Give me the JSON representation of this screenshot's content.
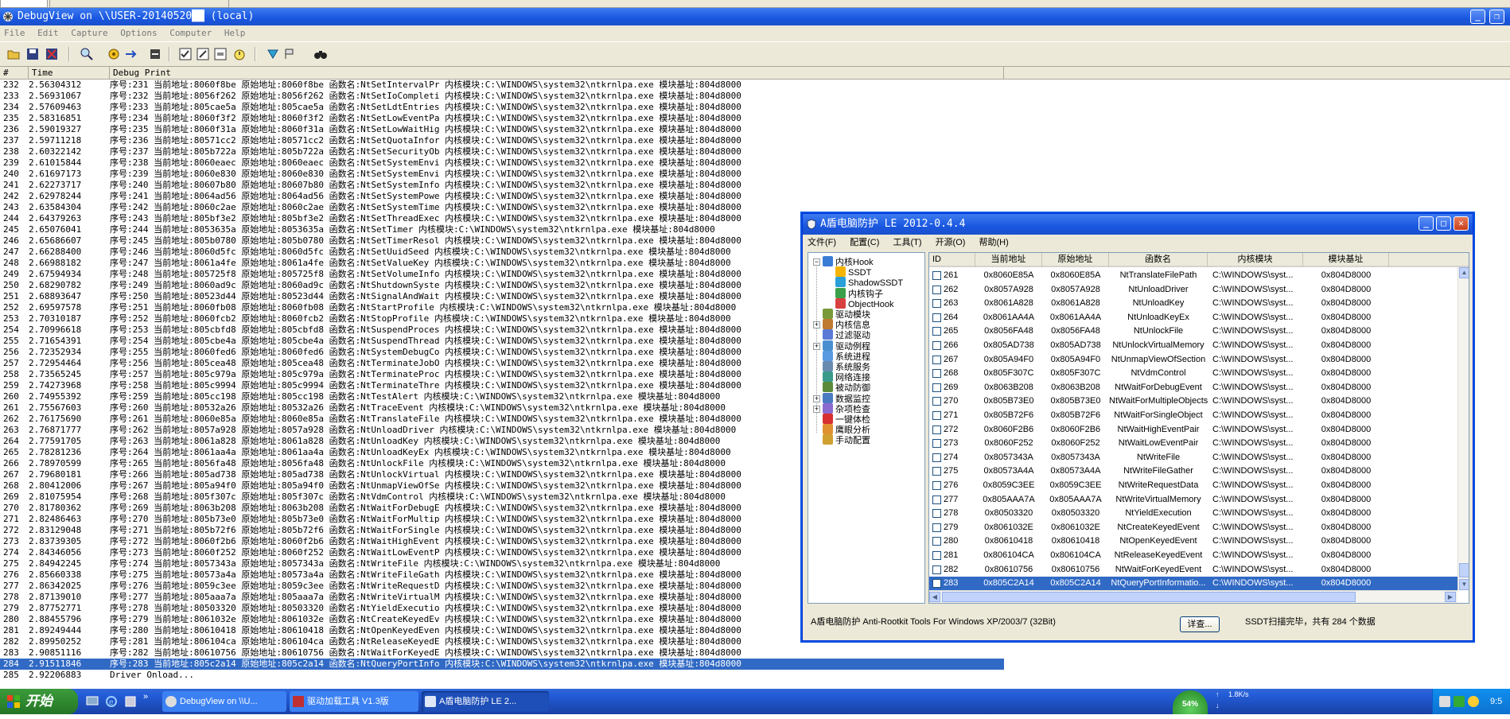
{
  "debugview": {
    "title": "DebugView on \\\\USER-20140520██ (local)",
    "menu": [
      "File",
      "Edit",
      "Capture",
      "Options",
      "Computer",
      "Help"
    ],
    "columns": {
      "num": "#",
      "time": "Time",
      "print": "Debug Print"
    },
    "rows": [
      [
        "232",
        "2.56304312",
        "序号:231 当前地址:8060f8be 原始地址:8060f8be 函数名:NtSetIntervalPr 内核模块:C:\\WINDOWS\\system32\\ntkrnlpa.exe 模块基址:804d8000"
      ],
      [
        "233",
        "2.56931067",
        "序号:232 当前地址:8056f262 原始地址:8056f262 函数名:NtSetIoCompleti 内核模块:C:\\WINDOWS\\system32\\ntkrnlpa.exe 模块基址:804d8000"
      ],
      [
        "234",
        "2.57609463",
        "序号:233 当前地址:805cae5a 原始地址:805cae5a 函数名:NtSetLdtEntries 内核模块:C:\\WINDOWS\\system32\\ntkrnlpa.exe 模块基址:804d8000"
      ],
      [
        "235",
        "2.58316851",
        "序号:234 当前地址:8060f3f2 原始地址:8060f3f2 函数名:NtSetLowEventPa 内核模块:C:\\WINDOWS\\system32\\ntkrnlpa.exe 模块基址:804d8000"
      ],
      [
        "236",
        "2.59019327",
        "序号:235 当前地址:8060f31a 原始地址:8060f31a 函数名:NtSetLowWaitHig 内核模块:C:\\WINDOWS\\system32\\ntkrnlpa.exe 模块基址:804d8000"
      ],
      [
        "237",
        "2.59711218",
        "序号:236 当前地址:80571cc2 原始地址:80571cc2 函数名:NtSetQuotaInfor 内核模块:C:\\WINDOWS\\system32\\ntkrnlpa.exe 模块基址:804d8000"
      ],
      [
        "238",
        "2.60322142",
        "序号:237 当前地址:805b722a 原始地址:805b722a 函数名:NtSetSecurityOb 内核模块:C:\\WINDOWS\\system32\\ntkrnlpa.exe 模块基址:804d8000"
      ],
      [
        "239",
        "2.61015844",
        "序号:238 当前地址:8060eaec 原始地址:8060eaec 函数名:NtSetSystemEnvi 内核模块:C:\\WINDOWS\\system32\\ntkrnlpa.exe 模块基址:804d8000"
      ],
      [
        "240",
        "2.61697173",
        "序号:239 当前地址:8060e830 原始地址:8060e830 函数名:NtSetSystemEnvi 内核模块:C:\\WINDOWS\\system32\\ntkrnlpa.exe 模块基址:804d8000"
      ],
      [
        "241",
        "2.62273717",
        "序号:240 当前地址:80607b80 原始地址:80607b80 函数名:NtSetSystemInfo 内核模块:C:\\WINDOWS\\system32\\ntkrnlpa.exe 模块基址:804d8000"
      ],
      [
        "242",
        "2.62978244",
        "序号:241 当前地址:8064ad56 原始地址:8064ad56 函数名:NtSetSystemPowe 内核模块:C:\\WINDOWS\\system32\\ntkrnlpa.exe 模块基址:804d8000"
      ],
      [
        "243",
        "2.63584304",
        "序号:242 当前地址:8060c2ae 原始地址:8060c2ae 函数名:NtSetSystemTime 内核模块:C:\\WINDOWS\\system32\\ntkrnlpa.exe 模块基址:804d8000"
      ],
      [
        "244",
        "2.64379263",
        "序号:243 当前地址:805bf3e2 原始地址:805bf3e2 函数名:NtSetThreadExec 内核模块:C:\\WINDOWS\\system32\\ntkrnlpa.exe 模块基址:804d8000"
      ],
      [
        "245",
        "2.65076041",
        "序号:244 当前地址:8053635a 原始地址:8053635a 函数名:NtSetTimer 内核模块:C:\\WINDOWS\\system32\\ntkrnlpa.exe 模块基址:804d8000"
      ],
      [
        "246",
        "2.65686607",
        "序号:245 当前地址:805b0780 原始地址:805b0780 函数名:NtSetTimerResol 内核模块:C:\\WINDOWS\\system32\\ntkrnlpa.exe 模块基址:804d8000"
      ],
      [
        "247",
        "2.66288400",
        "序号:246 当前地址:8060d5fc 原始地址:8060d5fc 函数名:NtSetUuidSeed 内核模块:C:\\WINDOWS\\system32\\ntkrnlpa.exe 模块基址:804d8000"
      ],
      [
        "248",
        "2.66988182",
        "序号:247 当前地址:8061a4fe 原始地址:8061a4fe 函数名:NtSetValueKey 内核模块:C:\\WINDOWS\\system32\\ntkrnlpa.exe 模块基址:804d8000"
      ],
      [
        "249",
        "2.67594934",
        "序号:248 当前地址:805725f8 原始地址:805725f8 函数名:NtSetVolumeInfo 内核模块:C:\\WINDOWS\\system32\\ntkrnlpa.exe 模块基址:804d8000"
      ],
      [
        "250",
        "2.68290782",
        "序号:249 当前地址:8060ad9c 原始地址:8060ad9c 函数名:NtShutdownSyste 内核模块:C:\\WINDOWS\\system32\\ntkrnlpa.exe 模块基址:804d8000"
      ],
      [
        "251",
        "2.68893647",
        "序号:250 当前地址:80523d44 原始地址:80523d44 函数名:NtSignalAndWait 内核模块:C:\\WINDOWS\\system32\\ntkrnlpa.exe 模块基址:804d8000"
      ],
      [
        "252",
        "2.69597578",
        "序号:251 当前地址:8060fb08 原始地址:8060fb08 函数名:NtStartProfile 内核模块:C:\\WINDOWS\\system32\\ntkrnlpa.exe 模块基址:804d8000"
      ],
      [
        "253",
        "2.70310187",
        "序号:252 当前地址:8060fcb2 原始地址:8060fcb2 函数名:NtStopProfile 内核模块:C:\\WINDOWS\\system32\\ntkrnlpa.exe 模块基址:804d8000"
      ],
      [
        "254",
        "2.70996618",
        "序号:253 当前地址:805cbfd8 原始地址:805cbfd8 函数名:NtSuspendProces 内核模块:C:\\WINDOWS\\system32\\ntkrnlpa.exe 模块基址:804d8000"
      ],
      [
        "255",
        "2.71654391",
        "序号:254 当前地址:805cbe4a 原始地址:805cbe4a 函数名:NtSuspendThread 内核模块:C:\\WINDOWS\\system32\\ntkrnlpa.exe 模块基址:804d8000"
      ],
      [
        "256",
        "2.72352934",
        "序号:255 当前地址:8060fed6 原始地址:8060fed6 函数名:NtSystemDebugCo 内核模块:C:\\WINDOWS\\system32\\ntkrnlpa.exe 模块基址:804d8000"
      ],
      [
        "257",
        "2.72954464",
        "序号:256 当前地址:805cea48 原始地址:805cea48 函数名:NtTerminateJobO 内核模块:C:\\WINDOWS\\system32\\ntkrnlpa.exe 模块基址:804d8000"
      ],
      [
        "258",
        "2.73565245",
        "序号:257 当前地址:805c979a 原始地址:805c979a 函数名:NtTerminateProc 内核模块:C:\\WINDOWS\\system32\\ntkrnlpa.exe 模块基址:804d8000"
      ],
      [
        "259",
        "2.74273968",
        "序号:258 当前地址:805c9994 原始地址:805c9994 函数名:NtTerminateThre 内核模块:C:\\WINDOWS\\system32\\ntkrnlpa.exe 模块基址:804d8000"
      ],
      [
        "260",
        "2.74955392",
        "序号:259 当前地址:805cc198 原始地址:805cc198 函数名:NtTestAlert 内核模块:C:\\WINDOWS\\system32\\ntkrnlpa.exe 模块基址:804d8000"
      ],
      [
        "261",
        "2.75567603",
        "序号:260 当前地址:80532a26 原始地址:80532a26 函数名:NtTraceEvent 内核模块:C:\\WINDOWS\\system32\\ntkrnlpa.exe 模块基址:804d8000"
      ],
      [
        "262",
        "2.76175690",
        "序号:261 当前地址:8060e85a 原始地址:8060e85a 函数名:NtTranslateFile 内核模块:C:\\WINDOWS\\system32\\ntkrnlpa.exe 模块基址:804d8000"
      ],
      [
        "263",
        "2.76871777",
        "序号:262 当前地址:8057a928 原始地址:8057a928 函数名:NtUnloadDriver 内核模块:C:\\WINDOWS\\system32\\ntkrnlpa.exe 模块基址:804d8000"
      ],
      [
        "264",
        "2.77591705",
        "序号:263 当前地址:8061a828 原始地址:8061a828 函数名:NtUnloadKey 内核模块:C:\\WINDOWS\\system32\\ntkrnlpa.exe 模块基址:804d8000"
      ],
      [
        "265",
        "2.78281236",
        "序号:264 当前地址:8061aa4a 原始地址:8061aa4a 函数名:NtUnloadKeyEx 内核模块:C:\\WINDOWS\\system32\\ntkrnlpa.exe 模块基址:804d8000"
      ],
      [
        "266",
        "2.78970599",
        "序号:265 当前地址:8056fa48 原始地址:8056fa48 函数名:NtUnlockFile 内核模块:C:\\WINDOWS\\system32\\ntkrnlpa.exe 模块基址:804d8000"
      ],
      [
        "267",
        "2.79680181",
        "序号:266 当前地址:805ad738 原始地址:805ad738 函数名:NtUnlockVirtual 内核模块:C:\\WINDOWS\\system32\\ntkrnlpa.exe 模块基址:804d8000"
      ],
      [
        "268",
        "2.80412006",
        "序号:267 当前地址:805a94f0 原始地址:805a94f0 函数名:NtUnmapViewOfSe 内核模块:C:\\WINDOWS\\system32\\ntkrnlpa.exe 模块基址:804d8000"
      ],
      [
        "269",
        "2.81075954",
        "序号:268 当前地址:805f307c 原始地址:805f307c 函数名:NtVdmControl 内核模块:C:\\WINDOWS\\system32\\ntkrnlpa.exe 模块基址:804d8000"
      ],
      [
        "270",
        "2.81780362",
        "序号:269 当前地址:8063b208 原始地址:8063b208 函数名:NtWaitForDebugE 内核模块:C:\\WINDOWS\\system32\\ntkrnlpa.exe 模块基址:804d8000"
      ],
      [
        "271",
        "2.82486463",
        "序号:270 当前地址:805b73e0 原始地址:805b73e0 函数名:NtWaitForMultip 内核模块:C:\\WINDOWS\\system32\\ntkrnlpa.exe 模块基址:804d8000"
      ],
      [
        "272",
        "2.83129048",
        "序号:271 当前地址:805b72f6 原始地址:805b72f6 函数名:NtWaitForSingle 内核模块:C:\\WINDOWS\\system32\\ntkrnlpa.exe 模块基址:804d8000"
      ],
      [
        "273",
        "2.83739305",
        "序号:272 当前地址:8060f2b6 原始地址:8060f2b6 函数名:NtWaitHighEvent 内核模块:C:\\WINDOWS\\system32\\ntkrnlpa.exe 模块基址:804d8000"
      ],
      [
        "274",
        "2.84346056",
        "序号:273 当前地址:8060f252 原始地址:8060f252 函数名:NtWaitLowEventP 内核模块:C:\\WINDOWS\\system32\\ntkrnlpa.exe 模块基址:804d8000"
      ],
      [
        "275",
        "2.84942245",
        "序号:274 当前地址:8057343a 原始地址:8057343a 函数名:NtWriteFile 内核模块:C:\\WINDOWS\\system32\\ntkrnlpa.exe 模块基址:804d8000"
      ],
      [
        "276",
        "2.85660338",
        "序号:275 当前地址:80573a4a 原始地址:80573a4a 函数名:NtWriteFileGath 内核模块:C:\\WINDOWS\\system32\\ntkrnlpa.exe 模块基址:804d8000"
      ],
      [
        "277",
        "2.86342025",
        "序号:276 当前地址:8059c3ee 原始地址:8059c3ee 函数名:NtWriteRequestD 内核模块:C:\\WINDOWS\\system32\\ntkrnlpa.exe 模块基址:804d8000"
      ],
      [
        "278",
        "2.87139010",
        "序号:277 当前地址:805aaa7a 原始地址:805aaa7a 函数名:NtWriteVirtualM 内核模块:C:\\WINDOWS\\system32\\ntkrnlpa.exe 模块基址:804d8000"
      ],
      [
        "279",
        "2.87752771",
        "序号:278 当前地址:80503320 原始地址:80503320 函数名:NtYieldExecutio 内核模块:C:\\WINDOWS\\system32\\ntkrnlpa.exe 模块基址:804d8000"
      ],
      [
        "280",
        "2.88455796",
        "序号:279 当前地址:8061032e 原始地址:8061032e 函数名:NtCreateKeyedEv 内核模块:C:\\WINDOWS\\system32\\ntkrnlpa.exe 模块基址:804d8000"
      ],
      [
        "281",
        "2.89249444",
        "序号:280 当前地址:80610418 原始地址:80610418 函数名:NtOpenKeyedEven 内核模块:C:\\WINDOWS\\system32\\ntkrnlpa.exe 模块基址:804d8000"
      ],
      [
        "282",
        "2.89950252",
        "序号:281 当前地址:806104ca 原始地址:806104ca 函数名:NtReleaseKeyedE 内核模块:C:\\WINDOWS\\system32\\ntkrnlpa.exe 模块基址:804d8000"
      ],
      [
        "283",
        "2.90851116",
        "序号:282 当前地址:80610756 原始地址:80610756 函数名:NtWaitForKeyedE 内核模块:C:\\WINDOWS\\system32\\ntkrnlpa.exe 模块基址:804d8000"
      ],
      [
        "284",
        "2.91511846",
        "序号:283 当前地址:805c2a14 原始地址:805c2a14 函数名:NtQueryPortInfo 内核模块:C:\\WINDOWS\\system32\\ntkrnlpa.exe 模块基址:804d8000"
      ],
      [
        "285",
        "2.92206883",
        "Driver Onload..."
      ]
    ],
    "selected_row": "284"
  },
  "antirootkit": {
    "title": "A盾电脑防护 LE 2012-0.4.4",
    "menu": [
      "文件(F)",
      "配置(C)",
      "工具(T)",
      "开源(O)",
      "帮助(H)"
    ],
    "tree": [
      {
        "label": "内核Hook",
        "depth": 0,
        "expander": "−",
        "icon": "hook-icon",
        "color": "#3a7bd5"
      },
      {
        "label": "SSDT",
        "depth": 1,
        "icon": "ssdt-icon",
        "color": "#f5b400"
      },
      {
        "label": "ShadowSSDT",
        "depth": 1,
        "icon": "shadow-ssdt-icon",
        "color": "#2a9fd8"
      },
      {
        "label": "内核钩子",
        "depth": 1,
        "icon": "kernel-hook-icon",
        "color": "#3aa04a"
      },
      {
        "label": "ObjectHook",
        "depth": 1,
        "icon": "object-hook-icon",
        "color": "#d84040"
      },
      {
        "label": "驱动模块",
        "depth": 0,
        "icon": "driver-module-icon",
        "color": "#7a9a3a"
      },
      {
        "label": "内核信息",
        "depth": 0,
        "expander": "+",
        "icon": "kernel-info-icon",
        "color": "#c07a30"
      },
      {
        "label": "过滤驱动",
        "depth": 0,
        "icon": "filter-driver-icon",
        "color": "#5a7ad5"
      },
      {
        "label": "驱动例程",
        "depth": 0,
        "expander": "+",
        "icon": "driver-routine-icon",
        "color": "#4a90d0"
      },
      {
        "label": "系统进程",
        "depth": 0,
        "icon": "system-process-icon",
        "color": "#5a9ae0"
      },
      {
        "label": "系统服务",
        "depth": 0,
        "icon": "system-service-icon",
        "color": "#6a8ab0"
      },
      {
        "label": "网络连接",
        "depth": 0,
        "icon": "network-icon",
        "color": "#3a9a8a"
      },
      {
        "label": "被动防御",
        "depth": 0,
        "icon": "passive-defense-icon",
        "color": "#5a8a3a"
      },
      {
        "label": "数据监控",
        "depth": 0,
        "expander": "+",
        "icon": "data-monitor-icon",
        "color": "#4a7ac0"
      },
      {
        "label": "杂项检查",
        "depth": 0,
        "expander": "+",
        "icon": "misc-check-icon",
        "color": "#8a6ad0"
      },
      {
        "label": "一键体检",
        "depth": 0,
        "icon": "one-click-check-icon",
        "color": "#d83030"
      },
      {
        "label": "鹰眼分析",
        "depth": 0,
        "icon": "eagle-eye-icon",
        "color": "#e09030"
      },
      {
        "label": "手动配置",
        "depth": 0,
        "icon": "manual-config-icon",
        "color": "#d0a030"
      }
    ],
    "columns": [
      "ID",
      "当前地址",
      "原始地址",
      "函数名",
      "内核模块",
      "模块基址"
    ],
    "rows": [
      [
        "261",
        "0x8060E85A",
        "0x8060E85A",
        "NtTranslateFilePath",
        "C:\\WINDOWS\\syst...",
        "0x804D8000"
      ],
      [
        "262",
        "0x8057A928",
        "0x8057A928",
        "NtUnloadDriver",
        "C:\\WINDOWS\\syst...",
        "0x804D8000"
      ],
      [
        "263",
        "0x8061A828",
        "0x8061A828",
        "NtUnloadKey",
        "C:\\WINDOWS\\syst...",
        "0x804D8000"
      ],
      [
        "264",
        "0x8061AA4A",
        "0x8061AA4A",
        "NtUnloadKeyEx",
        "C:\\WINDOWS\\syst...",
        "0x804D8000"
      ],
      [
        "265",
        "0x8056FA48",
        "0x8056FA48",
        "NtUnlockFile",
        "C:\\WINDOWS\\syst...",
        "0x804D8000"
      ],
      [
        "266",
        "0x805AD738",
        "0x805AD738",
        "NtUnlockVirtualMemory",
        "C:\\WINDOWS\\syst...",
        "0x804D8000"
      ],
      [
        "267",
        "0x805A94F0",
        "0x805A94F0",
        "NtUnmapViewOfSection",
        "C:\\WINDOWS\\syst...",
        "0x804D8000"
      ],
      [
        "268",
        "0x805F307C",
        "0x805F307C",
        "NtVdmControl",
        "C:\\WINDOWS\\syst...",
        "0x804D8000"
      ],
      [
        "269",
        "0x8063B208",
        "0x8063B208",
        "NtWaitForDebugEvent",
        "C:\\WINDOWS\\syst...",
        "0x804D8000"
      ],
      [
        "270",
        "0x805B73E0",
        "0x805B73E0",
        "NtWaitForMultipleObjects",
        "C:\\WINDOWS\\syst...",
        "0x804D8000"
      ],
      [
        "271",
        "0x805B72F6",
        "0x805B72F6",
        "NtWaitForSingleObject",
        "C:\\WINDOWS\\syst...",
        "0x804D8000"
      ],
      [
        "272",
        "0x8060F2B6",
        "0x8060F2B6",
        "NtWaitHighEventPair",
        "C:\\WINDOWS\\syst...",
        "0x804D8000"
      ],
      [
        "273",
        "0x8060F252",
        "0x8060F252",
        "NtWaitLowEventPair",
        "C:\\WINDOWS\\syst...",
        "0x804D8000"
      ],
      [
        "274",
        "0x8057343A",
        "0x8057343A",
        "NtWriteFile",
        "C:\\WINDOWS\\syst...",
        "0x804D8000"
      ],
      [
        "275",
        "0x80573A4A",
        "0x80573A4A",
        "NtWriteFileGather",
        "C:\\WINDOWS\\syst...",
        "0x804D8000"
      ],
      [
        "276",
        "0x8059C3EE",
        "0x8059C3EE",
        "NtWriteRequestData",
        "C:\\WINDOWS\\syst...",
        "0x804D8000"
      ],
      [
        "277",
        "0x805AAA7A",
        "0x805AAA7A",
        "NtWriteVirtualMemory",
        "C:\\WINDOWS\\syst...",
        "0x804D8000"
      ],
      [
        "278",
        "0x80503320",
        "0x80503320",
        "NtYieldExecution",
        "C:\\WINDOWS\\syst...",
        "0x804D8000"
      ],
      [
        "279",
        "0x8061032E",
        "0x8061032E",
        "NtCreateKeyedEvent",
        "C:\\WINDOWS\\syst...",
        "0x804D8000"
      ],
      [
        "280",
        "0x80610418",
        "0x80610418",
        "NtOpenKeyedEvent",
        "C:\\WINDOWS\\syst...",
        "0x804D8000"
      ],
      [
        "281",
        "0x806104CA",
        "0x806104CA",
        "NtReleaseKeyedEvent",
        "C:\\WINDOWS\\syst...",
        "0x804D8000"
      ],
      [
        "282",
        "0x80610756",
        "0x80610756",
        "NtWaitForKeyedEvent",
        "C:\\WINDOWS\\syst...",
        "0x804D8000"
      ],
      [
        "283",
        "0x805C2A14",
        "0x805C2A14",
        "NtQueryPortInformatio...",
        "C:\\WINDOWS\\syst...",
        "0x804D8000"
      ]
    ],
    "selected_row": "283",
    "status_left": "A盾电脑防护 Anti-Rootkit Tools For Windows XP/2003/7 (32Bit)",
    "detail_button": "详查...",
    "status_right": "SSDT扫描完毕，共有 284 个数据"
  },
  "taskbar": {
    "start": "开始",
    "items": [
      "DebugView on \\\\U...",
      "驱动加载工具 V1.3版",
      "A盾电脑防护 LE 2..."
    ],
    "net_speed": "1.8K/s",
    "cpu_percent": "54%",
    "clock": "9:5"
  },
  "colors": {
    "titlebar": "#1957e0",
    "selection": "#316ac5",
    "taskbar": "#245edb",
    "start": "#2f8a2f"
  }
}
